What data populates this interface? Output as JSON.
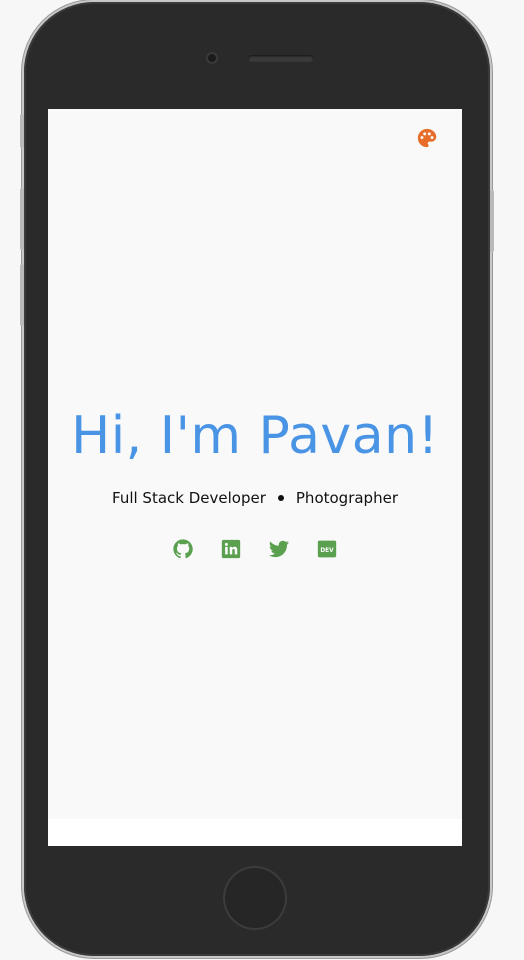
{
  "hero": {
    "title": "Hi, I'm Pavan!",
    "roles": [
      "Full Stack Developer",
      "Photographer"
    ]
  },
  "icons": {
    "theme": "palette-icon",
    "social": [
      "github-icon",
      "linkedin-icon",
      "twitter-icon",
      "dev-icon"
    ]
  },
  "colors": {
    "title": "#4a94e6",
    "social": "#5aa04f",
    "palette": "#e66e2a",
    "background": "#f9f9f9"
  },
  "social": {
    "dev_label": "DEV"
  }
}
